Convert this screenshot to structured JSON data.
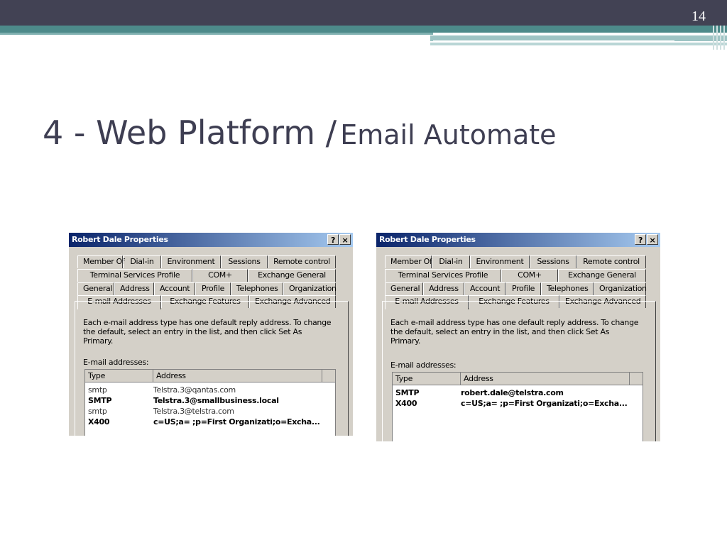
{
  "slide": {
    "number": "14",
    "title_main": "4 - Web Platform /",
    "title_sub": "Email Automate"
  },
  "dialogs": [
    {
      "title": "Robert Dale Properties",
      "help_label": "?",
      "close_label": "×",
      "tabs_row1": [
        "Member Of",
        "Dial-in",
        "Environment",
        "Sessions",
        "Remote control"
      ],
      "tabs_row2": [
        "Terminal Services Profile",
        "COM+",
        "Exchange General"
      ],
      "tabs_row3": [
        "General",
        "Address",
        "Account",
        "Profile",
        "Telephones",
        "Organization"
      ],
      "tabs_row4": [
        "E-mail Addresses",
        "Exchange Features",
        "Exchange Advanced"
      ],
      "description": "Each e-mail address type has one default reply address. To change the default, select an entry in the list, and then click Set As Primary.",
      "addresses_label": "E-mail addresses:",
      "columns": [
        "Type",
        "Address"
      ],
      "rows": [
        {
          "type": "smtp",
          "address": "Telstra.3@qantas.com",
          "primary": false
        },
        {
          "type": "SMTP",
          "address": "Telstra.3@smallbusiness.local",
          "primary": true
        },
        {
          "type": "smtp",
          "address": "Telstra.3@telstra.com",
          "primary": false
        },
        {
          "type": "X400",
          "address": "c=US;a= ;p=First Organizati;o=Excha...",
          "primary": true
        }
      ]
    },
    {
      "title": "Robert Dale Properties",
      "help_label": "?",
      "close_label": "×",
      "tabs_row1": [
        "Member Of",
        "Dial-in",
        "Environment",
        "Sessions",
        "Remote control"
      ],
      "tabs_row2": [
        "Terminal Services Profile",
        "COM+",
        "Exchange General"
      ],
      "tabs_row3": [
        "General",
        "Address",
        "Account",
        "Profile",
        "Telephones",
        "Organization"
      ],
      "tabs_row4": [
        "E-mail Addresses",
        "Exchange Features",
        "Exchange Advanced"
      ],
      "description": "Each e-mail address type has one default reply address. To change the default, select an entry in the list, and then click Set As Primary.",
      "addresses_label": "E-mail addresses:",
      "columns": [
        "Type",
        "Address"
      ],
      "rows": [
        {
          "type": "SMTP",
          "address": "robert.dale@telstra.com",
          "primary": true
        },
        {
          "type": "X400",
          "address": "c=US;a= ;p=First Organizati;o=Excha...",
          "primary": true
        }
      ]
    }
  ],
  "colors": {
    "top_bar": "#424254",
    "accent_teal": "#4d8a8a",
    "title_text": "#3e3e52",
    "dialog_face": "#d4d0c8",
    "titlebar_start": "#0a246a",
    "titlebar_end": "#a6caf0"
  }
}
